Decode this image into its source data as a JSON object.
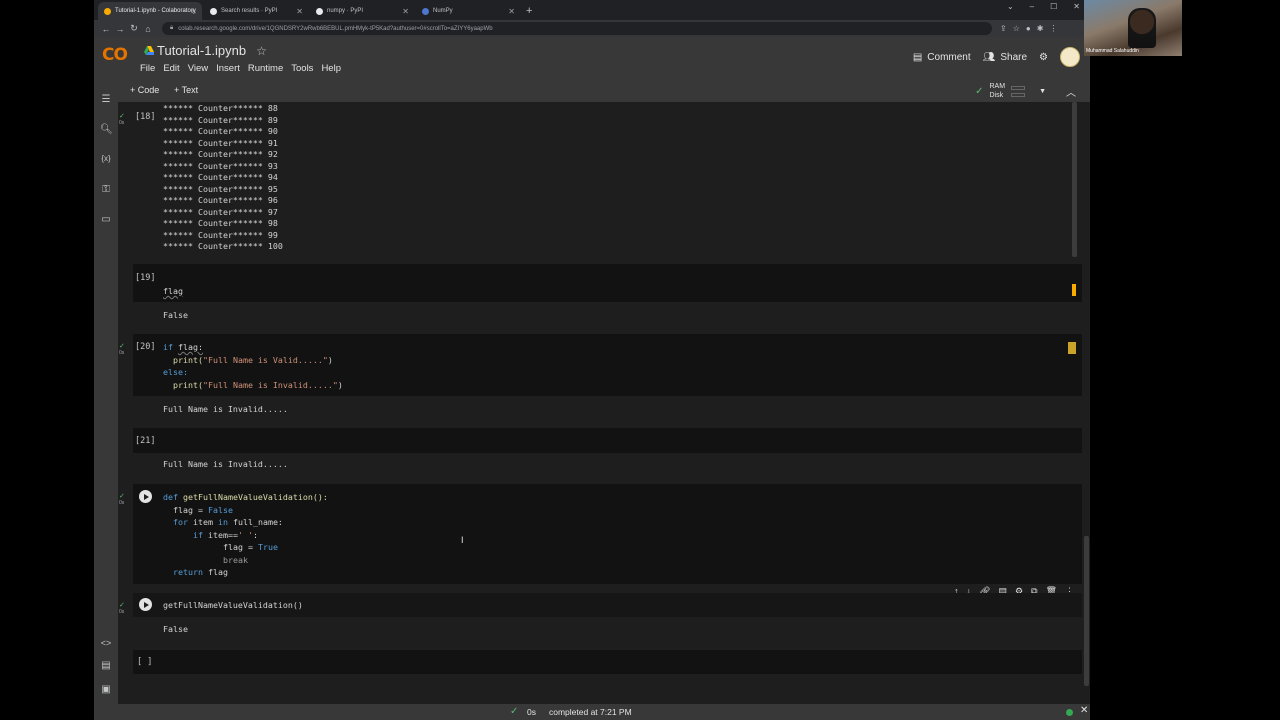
{
  "browser": {
    "tabs": [
      {
        "title": "Tutorial-1.ipynb - Colaboratory",
        "fav": "#f9ab00",
        "active": true
      },
      {
        "title": "Search results · PyPI",
        "fav": "#e8eaed",
        "active": false
      },
      {
        "title": "numpy · PyPI",
        "fav": "#e8eaed",
        "active": false
      },
      {
        "title": "NumPy",
        "fav": "#4d77cf",
        "active": false
      }
    ],
    "url": "colab.research.google.com/drive/1QGNDSRY2wRwb6BEBUL.pmHMyk-tP5Kad?authuser=0#scrollTo=aZIYY6yaapWb"
  },
  "colab": {
    "logo": "CO",
    "title": "Tutorial-1.ipynb",
    "menus": [
      "File",
      "Edit",
      "View",
      "Insert",
      "Runtime",
      "Tools",
      "Help"
    ],
    "comment_label": "Comment",
    "share_label": "Share",
    "add_code_label": "+ Code",
    "add_text_label": "+ Text",
    "ram_label": "RAM",
    "disk_label": "Disk"
  },
  "cells": {
    "c18": {
      "exec": "[18]",
      "output": [
        "****** Counter****** 88",
        "****** Counter****** 89",
        "****** Counter****** 90",
        "****** Counter****** 91",
        "****** Counter****** 92",
        "****** Counter****** 93",
        "****** Counter****** 94",
        "****** Counter****** 95",
        "****** Counter****** 96",
        "****** Counter****** 97",
        "****** Counter****** 98",
        "****** Counter****** 99",
        "****** Counter****** 100"
      ]
    },
    "c19": {
      "exec": "[19]",
      "code": "flag",
      "output": "False"
    },
    "c20": {
      "exec": "[20]",
      "code_if": "if",
      "code_flag": "flag:",
      "code_print1": "print(",
      "code_str1": "\"Full Name is Valid.....\"",
      "code_print2": "print(",
      "code_str2": "\"Full Name is Invalid.....\"",
      "code_else": "else:",
      "close": ")",
      "output": "Full Name is Invalid....."
    },
    "c21": {
      "exec": "[21]",
      "output": "Full Name is Invalid....."
    },
    "cdef": {
      "def": "def",
      "fname": "getFullNameValueValidation():",
      "l2a": "flag = ",
      "l2b": "False",
      "l3a": "for",
      "l3b": " item ",
      "l3c": "in",
      "l3d": " full_name:",
      "l4a": "if",
      "l4b": " item==",
      "l4c": "' '",
      "l4d": ":",
      "l5a": "flag = ",
      "l5b": "True",
      "l6": "break",
      "l7a": "return",
      "l7b": " flag"
    },
    "ccall": {
      "code": "getFullNameValueValidation()",
      "output": "False"
    },
    "cempty": {
      "exec": "[ ]"
    },
    "check_time": "0s"
  },
  "status": {
    "time": "0s",
    "completed": "completed at 7:21 PM"
  },
  "webcam": {
    "name": "Muhammad Salahuddin"
  }
}
